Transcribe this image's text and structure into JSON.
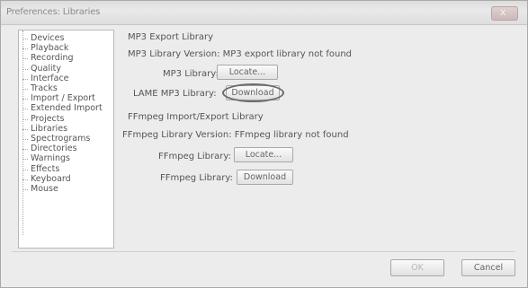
{
  "window": {
    "title": "Preferences: Libraries",
    "close_glyph": "x"
  },
  "sidebar": {
    "items": [
      {
        "label": "Devices"
      },
      {
        "label": "Playback"
      },
      {
        "label": "Recording"
      },
      {
        "label": "Quality"
      },
      {
        "label": "Interface"
      },
      {
        "label": "Tracks"
      },
      {
        "label": "Import / Export"
      },
      {
        "label": "Extended Import"
      },
      {
        "label": "Projects"
      },
      {
        "label": "Libraries"
      },
      {
        "label": "Spectrograms"
      },
      {
        "label": "Directories"
      },
      {
        "label": "Warnings"
      },
      {
        "label": "Effects"
      },
      {
        "label": "Keyboard"
      },
      {
        "label": "Mouse"
      }
    ]
  },
  "mp3": {
    "section_title": "MP3 Export Library",
    "version_text": "MP3 Library Version: MP3 export library not found",
    "library_label": "MP3 Library:",
    "locate_label": "Locate...",
    "lame_label": "LAME MP3 Library:",
    "download_label": "Download"
  },
  "ffmpeg": {
    "section_title": "FFmpeg Import/Export Library",
    "version_text": "FFmpeg Library Version: FFmpeg library not found",
    "library_label": "FFmpeg Library:",
    "locate_label": "Locate...",
    "library_label2": "FFmpeg Library:",
    "download_label": "Download"
  },
  "footer": {
    "ok_label": "OK",
    "cancel_label": "Cancel"
  }
}
